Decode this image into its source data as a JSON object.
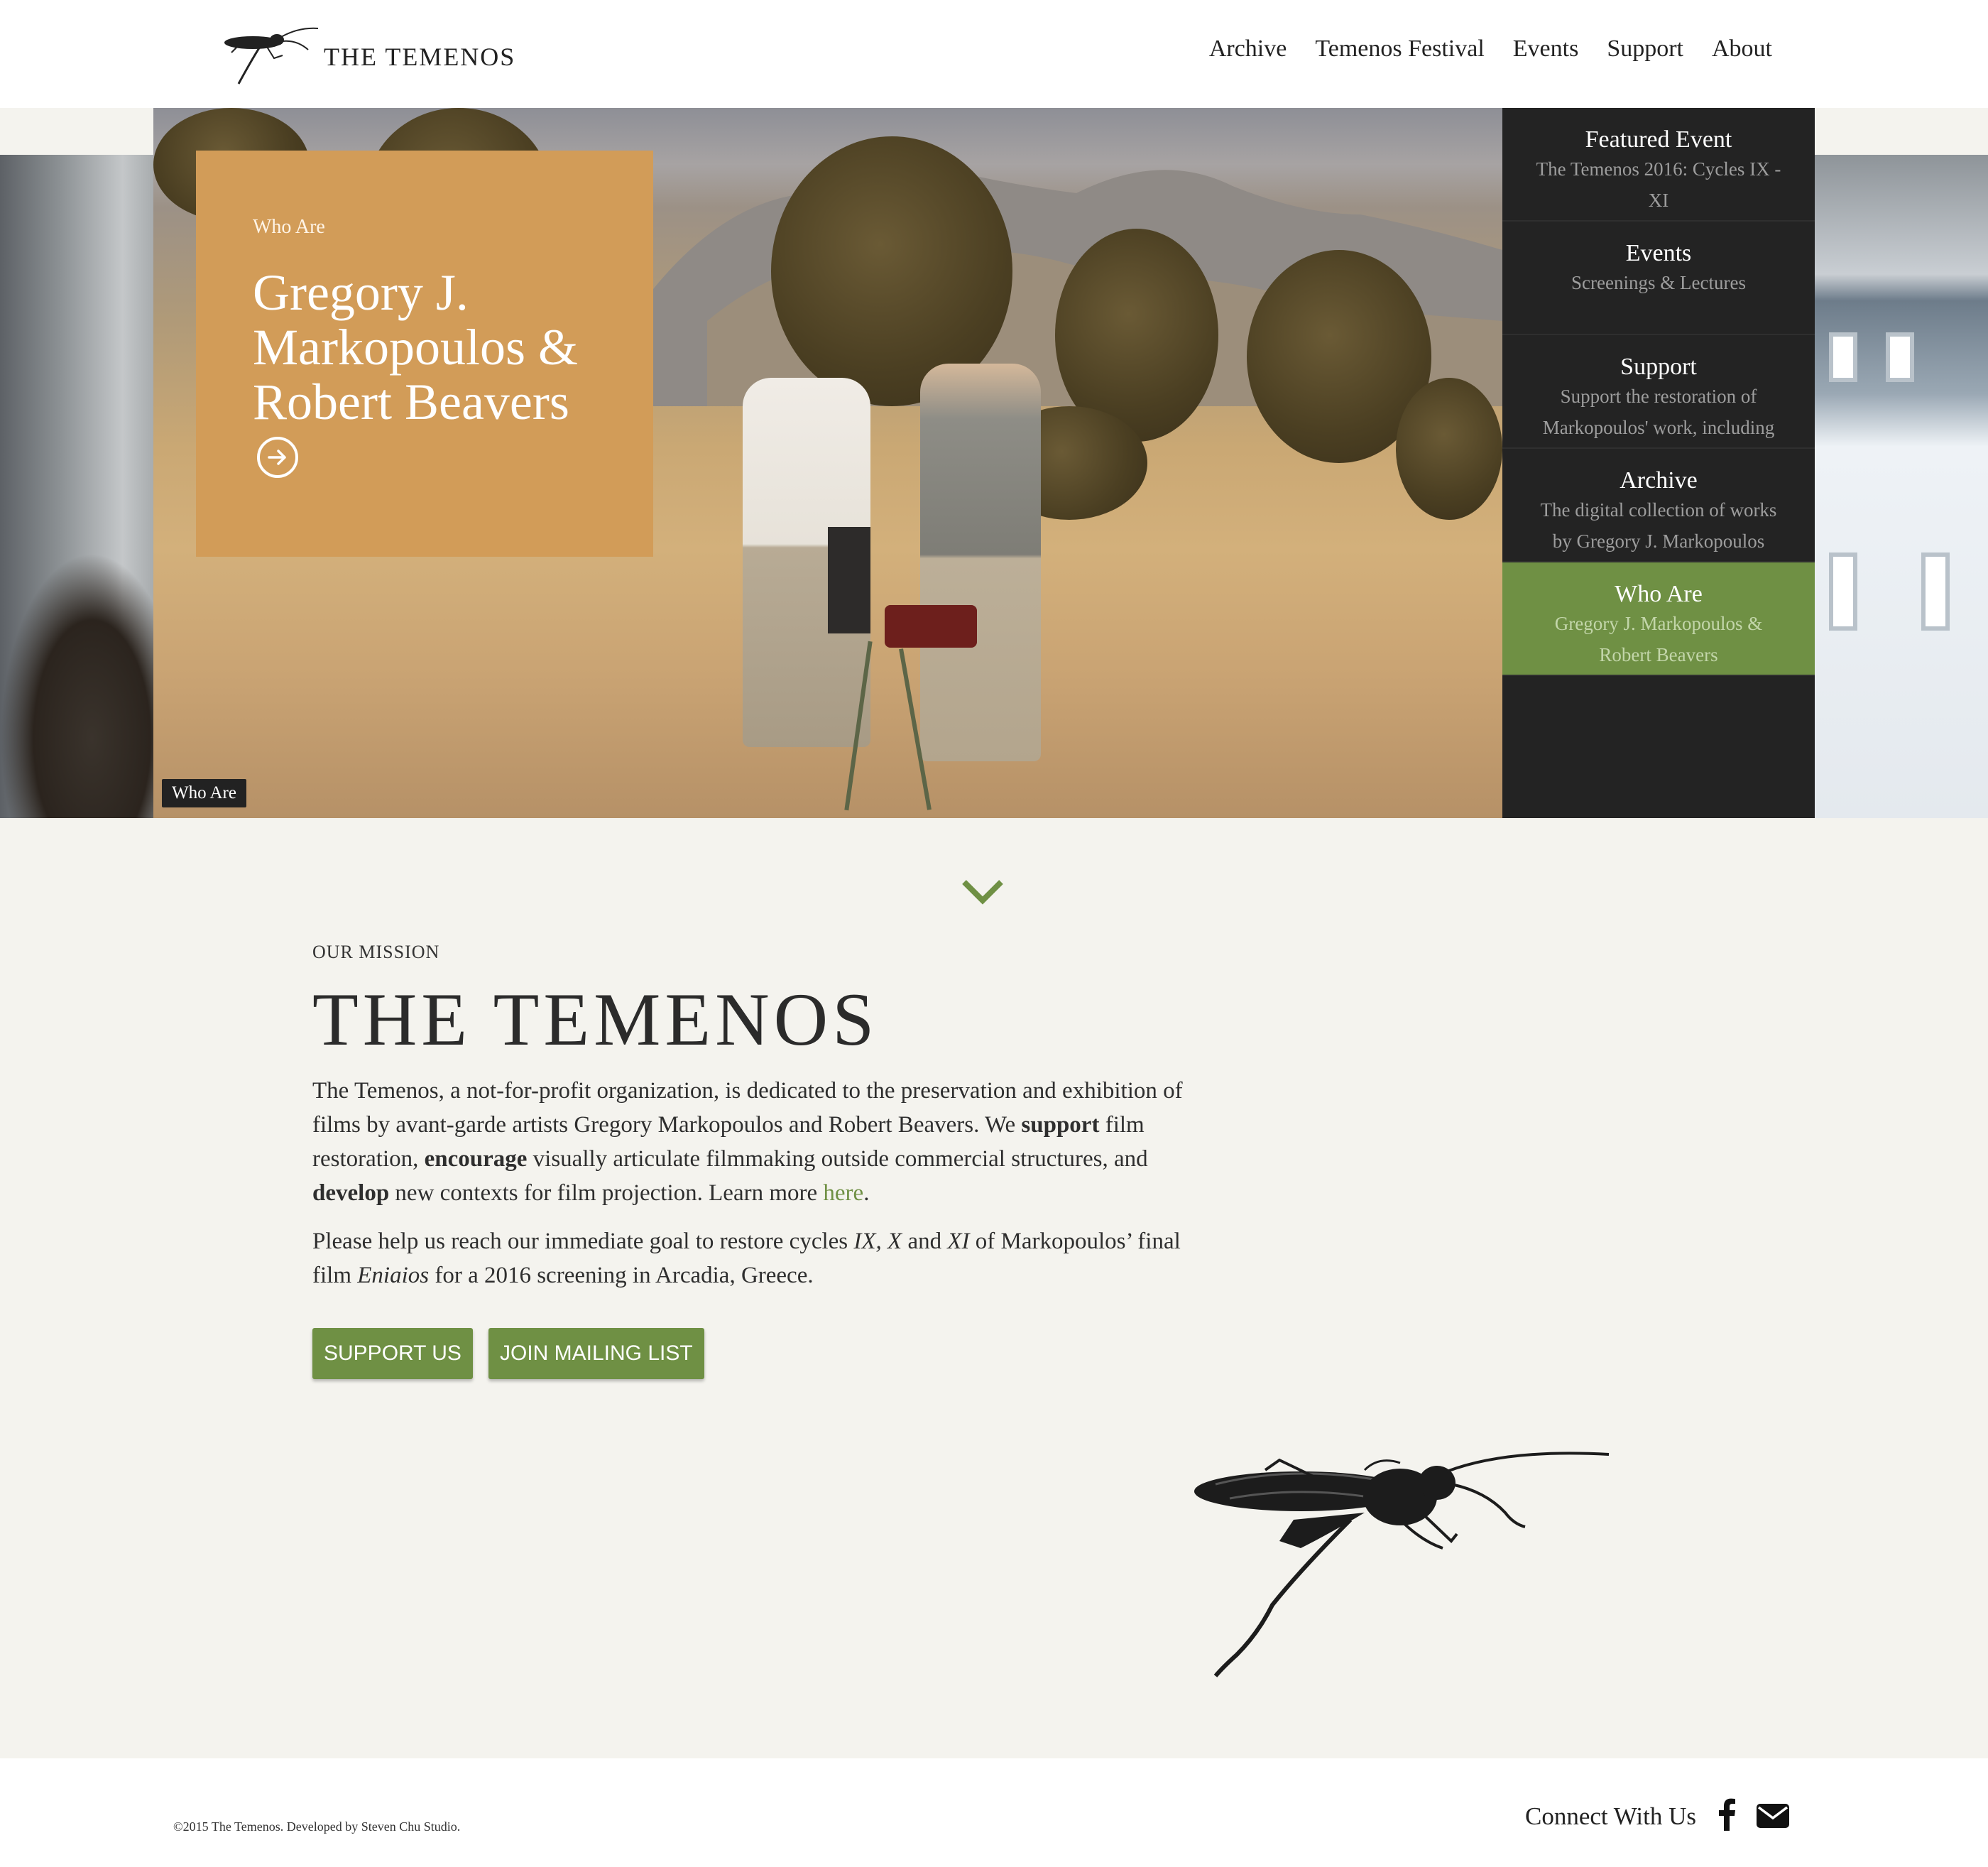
{
  "header": {
    "site_title": "THE TEMENOS",
    "nav": [
      "Archive",
      "Temenos Festival",
      "Events",
      "Support",
      "About"
    ]
  },
  "hero": {
    "card_eyebrow": "Who Are",
    "card_title": "Gregory J. Markopoulos & Robert Beavers",
    "caption_tag": "Who Are"
  },
  "side_panel": [
    {
      "title": "Featured Event",
      "desc": "The Temenos 2016: Cycles IX - XI",
      "active": false
    },
    {
      "title": "Events",
      "desc": "Screenings & Lectures",
      "active": false
    },
    {
      "title": "Support",
      "desc": "Support the restoration of Markopoulos' work, including",
      "active": false
    },
    {
      "title": "Archive",
      "desc": "The digital collection of works by Gregory J. Markopoulos",
      "active": false
    },
    {
      "title": "Who Are",
      "desc": "Gregory J. Markopoulos & Robert Beavers",
      "active": true
    }
  ],
  "mission": {
    "eyebrow": "OUR MISSION",
    "title": "THE TEMENOS",
    "p1_a": "The Temenos, a not-for-profit organization, is dedicated to the preservation and exhibition of films by avant-garde artists Gregory Markopoulos and Robert Beavers. We ",
    "p1_b": "support",
    "p1_c": " film restoration, ",
    "p1_d": "encourage",
    "p1_e": " visually articulate filmmaking outside commercial structures, and ",
    "p1_f": "develop",
    "p1_g": " new contexts for film projection. Learn more ",
    "p1_link": "here",
    "p1_end": ".",
    "p2_a": "Please help us reach our immediate goal to restore cycles ",
    "p2_ix": "IX, X",
    "p2_b": " and ",
    "p2_xi": "XI",
    "p2_c": " of Markopoulos’ final film ",
    "p2_film": "Eniaios",
    "p2_d": " for a 2016 screening in Arcadia, Greece.",
    "btn_support": "SUPPORT US",
    "btn_mailing": "JOIN MAILING LIST"
  },
  "footer": {
    "copyright": "©2015 The Temenos. Developed by Steven Chu Studio.",
    "connect": "Connect With Us"
  },
  "colors": {
    "accent_green": "#6f9044",
    "card_orange": "#d29c58",
    "panel_dark": "#232323",
    "page_bg": "#f4f3ee"
  },
  "icons": [
    "insect-logo-icon",
    "arrow-right-circle-icon",
    "chevron-down-icon",
    "facebook-icon",
    "mail-icon",
    "insect-illustration"
  ]
}
